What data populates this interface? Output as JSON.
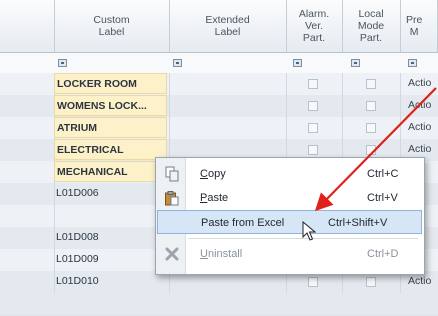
{
  "columns": [
    {
      "id": "custom",
      "label": "Custom\nLabel"
    },
    {
      "id": "extended",
      "label": "Extended\nLabel"
    },
    {
      "id": "alarm",
      "label": "Alarm.\nVer.\nPart."
    },
    {
      "id": "local",
      "label": "Local\nMode\nPart."
    },
    {
      "id": "pre",
      "label": "Pre\nM"
    }
  ],
  "rows": [
    {
      "label": "LOCKER ROOM",
      "highlight": true,
      "action": "Actio"
    },
    {
      "label": "WOMENS LOCK...",
      "highlight": true,
      "action": "Actio"
    },
    {
      "label": "ATRIUM",
      "highlight": true,
      "action": "Actio"
    },
    {
      "label": "ELECTRICAL",
      "highlight": true,
      "action": "Actio"
    },
    {
      "label": "MECHANICAL",
      "highlight": true,
      "action": "tio"
    },
    {
      "label": "L01D006",
      "highlight": false,
      "action": "tio"
    },
    {
      "label": "",
      "highlight": false,
      "action": ""
    },
    {
      "label": "L01D008",
      "highlight": false,
      "action": "tio"
    },
    {
      "label": "L01D009",
      "highlight": false,
      "action": "tio"
    },
    {
      "label": "L01D010",
      "highlight": false,
      "action": "Actio"
    }
  ],
  "context_menu": {
    "items": [
      {
        "label": "Copy",
        "accel": "C",
        "shortcut": "Ctrl+C",
        "icon": "copy-icon",
        "state": "normal"
      },
      {
        "label": "Paste",
        "accel": "P",
        "shortcut": "Ctrl+V",
        "icon": "paste-icon",
        "state": "normal"
      },
      {
        "label": "Paste from Excel",
        "accel": "",
        "shortcut": "Ctrl+Shift+V",
        "icon": "",
        "state": "selected"
      },
      {
        "label": "Uninstall",
        "accel": "U",
        "shortcut": "Ctrl+D",
        "icon": "uninstall-icon",
        "state": "disabled"
      }
    ]
  },
  "annotation": {
    "arrow_color": "#e0201c"
  },
  "colors": {
    "highlight_cell": "#fdf1c9",
    "selected_item": "#d7e6f6"
  }
}
